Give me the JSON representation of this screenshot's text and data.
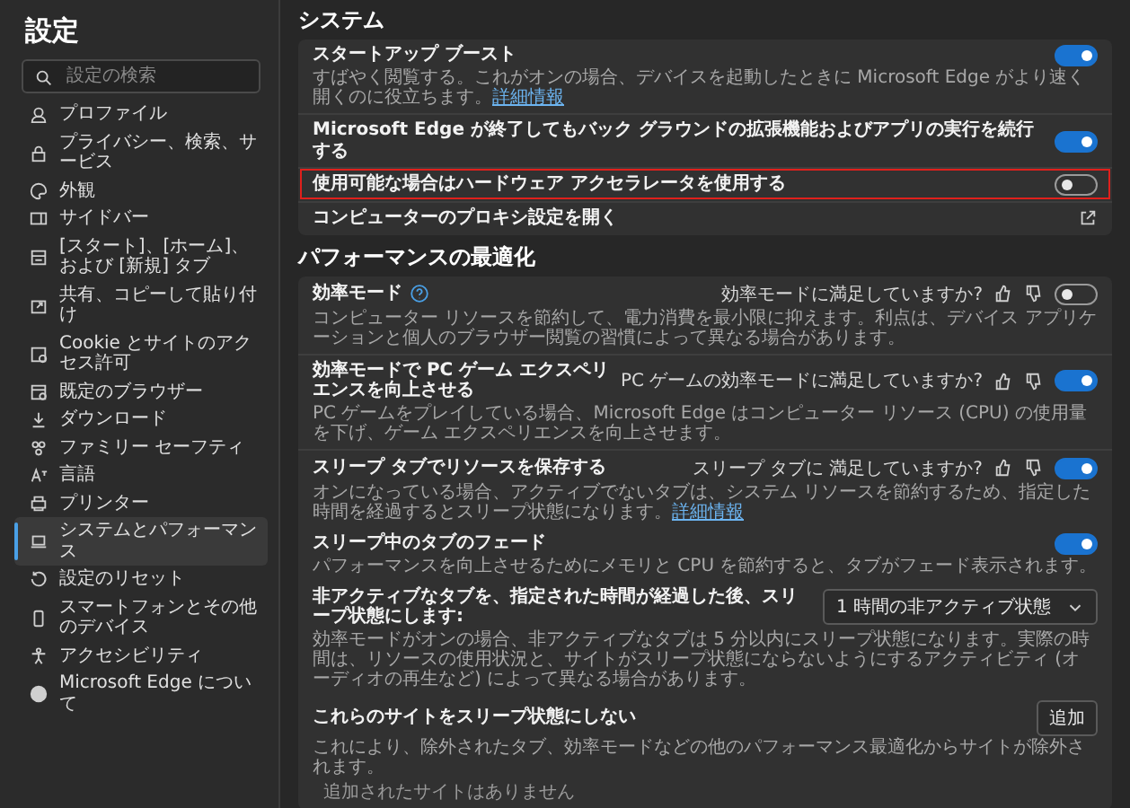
{
  "sidebar": {
    "title": "設定",
    "search": {
      "placeholder": "設定の検索"
    },
    "items": [
      {
        "label": "プロファイル",
        "selected": false
      },
      {
        "label": "プライバシー、検索、サービス",
        "selected": false
      },
      {
        "label": "外観",
        "selected": false
      },
      {
        "label": "サイドバー",
        "selected": false
      },
      {
        "label": "[スタート]、[ホーム]、および [新規] タブ",
        "selected": false
      },
      {
        "label": "共有、コピーして貼り付け",
        "selected": false
      },
      {
        "label": "Cookie とサイトのアクセス許可",
        "selected": false
      },
      {
        "label": "既定のブラウザー",
        "selected": false
      },
      {
        "label": "ダウンロード",
        "selected": false
      },
      {
        "label": "ファミリー セーフティ",
        "selected": false
      },
      {
        "label": "言語",
        "selected": false
      },
      {
        "label": "プリンター",
        "selected": false
      },
      {
        "label": "システムとパフォーマンス",
        "selected": true
      },
      {
        "label": "設定のリセット",
        "selected": false
      },
      {
        "label": "スマートフォンとその他のデバイス",
        "selected": false
      },
      {
        "label": "アクセシビリティ",
        "selected": false
      },
      {
        "label": "Microsoft Edge について",
        "selected": false
      }
    ]
  },
  "system": {
    "heading": "システム",
    "rows": [
      {
        "kind": "toggle",
        "title": "スタートアップ ブースト",
        "description": "すばやく閲覧する。これがオンの場合、デバイスを起動したときに Microsoft Edge がより速く開くのに役立ちます。",
        "link": "詳細情報",
        "on": true,
        "highlighted": false
      },
      {
        "kind": "toggle",
        "title": "Microsoft Edge が終了してもバック グラウンドの拡張機能およびアプリの実行を続行する",
        "on": true,
        "highlighted": false
      },
      {
        "kind": "toggle",
        "title": "使用可能な場合はハードウェア アクセラレータを使用する",
        "on": false,
        "highlighted": true
      },
      {
        "kind": "external",
        "title": "コンピューターのプロキシ設定を開く",
        "highlighted": false
      }
    ]
  },
  "performance": {
    "heading": "パフォーマンスの最適化",
    "groups": [
      [
        {
          "kind": "toggle",
          "title": "効率モード",
          "help": true,
          "feedback": "効率モードに満足していますか?",
          "on": false,
          "description": "コンピューター リソースを節約して、電力消費を最小限に抑えます。利点は、デバイス アプリケーションと個人のブラウザー閲覧の習慣によって異なる場合があります。"
        }
      ],
      [
        {
          "kind": "toggle",
          "title": "効率モードで PC ゲーム エクスペリエンスを向上させる",
          "feedback": "PC ゲームの効率モードに満足していますか?",
          "on": true,
          "description": "PC ゲームをプレイしている場合、Microsoft Edge はコンピューター リソース (CPU) の使用量を下げ、ゲーム エクスペリエンスを向上させます。"
        }
      ],
      [
        {
          "kind": "toggle",
          "title": "スリープ タブでリソースを保存する",
          "feedback": "スリープ タブに 満足していますか?",
          "on": true,
          "description": "オンになっている場合、アクティブでないタブは、システム リソースを節約するため、指定した時間を経過するとスリープ状態になります。",
          "link": "詳細情報"
        },
        {
          "kind": "toggle",
          "title": "スリープ中のタブのフェード",
          "on": true,
          "description": "パフォーマンスを向上させるためにメモリと CPU を節約すると、タブがフェード表示されます。"
        },
        {
          "kind": "select",
          "title": "非アクティブなタブを、指定された時間が経過した後、スリープ状態にします:",
          "value": "1 時間の非アクティブ状態",
          "description": "効率モードがオンの場合、非アクティブなタブは 5 分以内にスリープ状態になります。実際の時間は、リソースの使用状況と、サイトがスリープ状態にならないようにするアクティビティ (オーディオの再生など) によって異なる場合があります。"
        },
        {
          "kind": "button",
          "title": "これらのサイトをスリープ状態にしない",
          "button": "追加",
          "description": "これにより、除外されたタブ、効率モードなどの他のパフォーマンス最適化からサイトが除外されます。",
          "note": "追加されたサイトはありません"
        }
      ]
    ]
  }
}
